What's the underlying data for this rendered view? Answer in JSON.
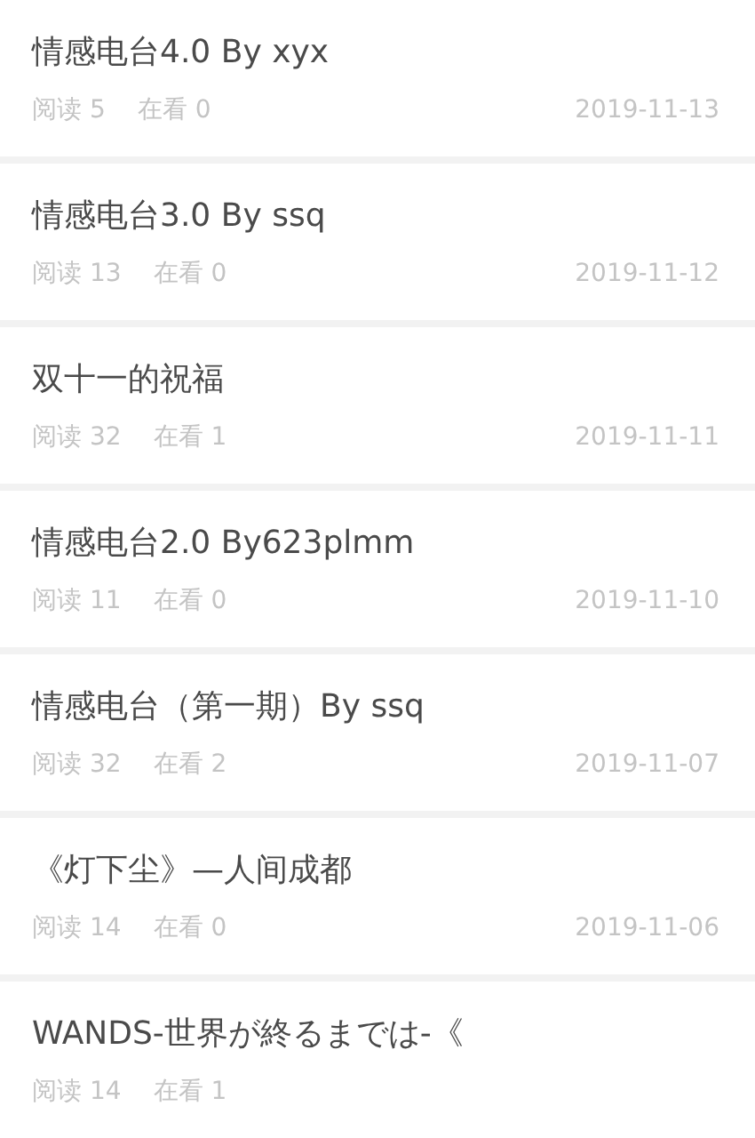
{
  "articles": [
    {
      "title": "情感电台4.0 By xyx",
      "reads_label": "阅读",
      "reads": "5",
      "viewing_label": "在看",
      "viewing": "0",
      "date": "2019-11-13"
    },
    {
      "title": "情感电台3.0 By ssq",
      "reads_label": "阅读",
      "reads": "13",
      "viewing_label": "在看",
      "viewing": "0",
      "date": "2019-11-12"
    },
    {
      "title": "双十一的祝福",
      "reads_label": "阅读",
      "reads": "32",
      "viewing_label": "在看",
      "viewing": "1",
      "date": "2019-11-11"
    },
    {
      "title": "情感电台2.0 By623plmm",
      "reads_label": "阅读",
      "reads": "11",
      "viewing_label": "在看",
      "viewing": "0",
      "date": "2019-11-10"
    },
    {
      "title": "情感电台（第一期）By ssq",
      "reads_label": "阅读",
      "reads": "32",
      "viewing_label": "在看",
      "viewing": "2",
      "date": "2019-11-07"
    },
    {
      "title": "《灯下尘》—人间成都",
      "reads_label": "阅读",
      "reads": "14",
      "viewing_label": "在看",
      "viewing": "0",
      "date": "2019-11-06"
    },
    {
      "title": "WANDS-世界が終るまでは-《",
      "reads_label": "阅读",
      "reads": "14",
      "viewing_label": "在看",
      "viewing": "1"
    }
  ]
}
